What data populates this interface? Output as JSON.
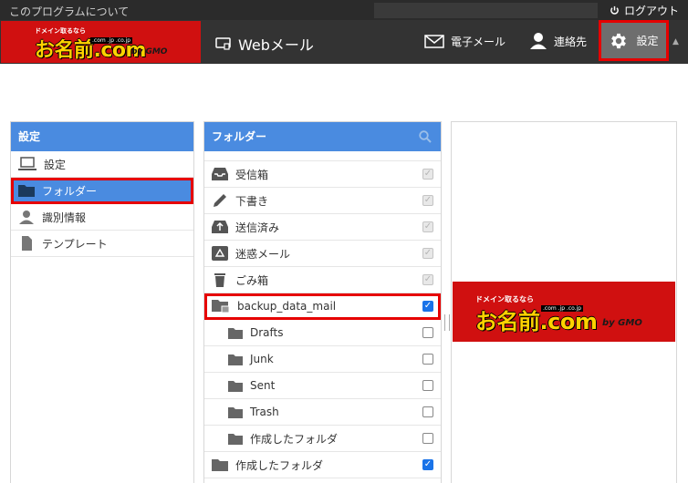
{
  "topbar": {
    "about": "このプログラムについて",
    "logout": "ログアウト"
  },
  "brand": {
    "tagline": "ドメイン取るなら",
    "name": "お名前.com",
    "domains": ".com .jp .co.jp",
    "company": "by GMO"
  },
  "header": {
    "webmail": "Webメール",
    "nav": {
      "mail": "電子メール",
      "contacts": "連絡先",
      "settings": "設定"
    }
  },
  "left_panel": {
    "title": "設定",
    "items": [
      {
        "label": "設定",
        "icon": "laptop-icon"
      },
      {
        "label": "フォルダー",
        "icon": "folder-icon"
      },
      {
        "label": "識別情報",
        "icon": "person-icon"
      },
      {
        "label": "テンプレート",
        "icon": "document-icon"
      }
    ]
  },
  "folders_panel": {
    "title": "フォルダー",
    "items": [
      {
        "label": "受信箱",
        "icon": "inbox-icon",
        "checked": true,
        "disabled": true
      },
      {
        "label": "下書き",
        "icon": "pencil-icon",
        "checked": true,
        "disabled": true
      },
      {
        "label": "送信済み",
        "icon": "sent-icon",
        "checked": true,
        "disabled": true
      },
      {
        "label": "迷惑メール",
        "icon": "recycle-icon",
        "checked": true,
        "disabled": true
      },
      {
        "label": "ごみ箱",
        "icon": "trash-icon",
        "checked": true,
        "disabled": true
      },
      {
        "label": "backup_data_mail",
        "icon": "folder-icon",
        "checked": true,
        "disabled": false
      },
      {
        "label": "Drafts",
        "icon": "folder-icon",
        "checked": false,
        "disabled": false
      },
      {
        "label": "Junk",
        "icon": "folder-icon",
        "checked": false,
        "disabled": false
      },
      {
        "label": "Sent",
        "icon": "folder-icon",
        "checked": false,
        "disabled": false
      },
      {
        "label": "Trash",
        "icon": "folder-icon",
        "checked": false,
        "disabled": false
      },
      {
        "label": "作成したフォルダ",
        "icon": "folder-icon",
        "checked": false,
        "disabled": false
      },
      {
        "label": "作成したフォルダ",
        "icon": "folder-icon",
        "checked": true,
        "disabled": false
      }
    ]
  },
  "colors": {
    "accent": "#4a8be0",
    "header": "#333333",
    "brand_red": "#d01010",
    "highlight": "#e60000"
  }
}
